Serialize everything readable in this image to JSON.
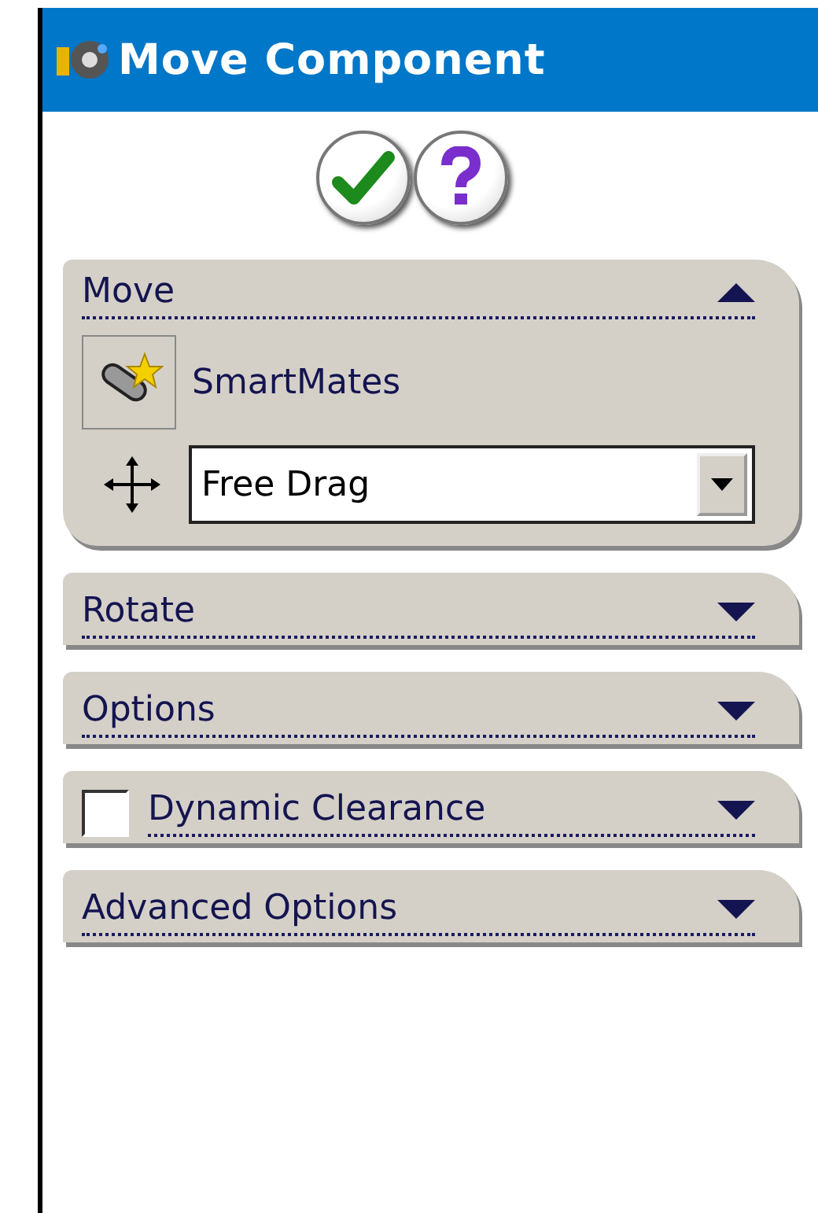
{
  "title": "Move Component",
  "sections": [
    {
      "kind": "panel",
      "title": "Move",
      "expanded": true,
      "smartmates": {
        "label": "SmartMates"
      },
      "mode": {
        "value": "Free Drag"
      }
    },
    {
      "kind": "header",
      "title": "Rotate",
      "expanded": false
    },
    {
      "kind": "header",
      "title": "Options",
      "expanded": false
    },
    {
      "kind": "checkbox",
      "title": "Dynamic Clearance",
      "expanded": false,
      "checked": false
    },
    {
      "kind": "header",
      "title": "Advanced Options",
      "expanded": false
    }
  ]
}
